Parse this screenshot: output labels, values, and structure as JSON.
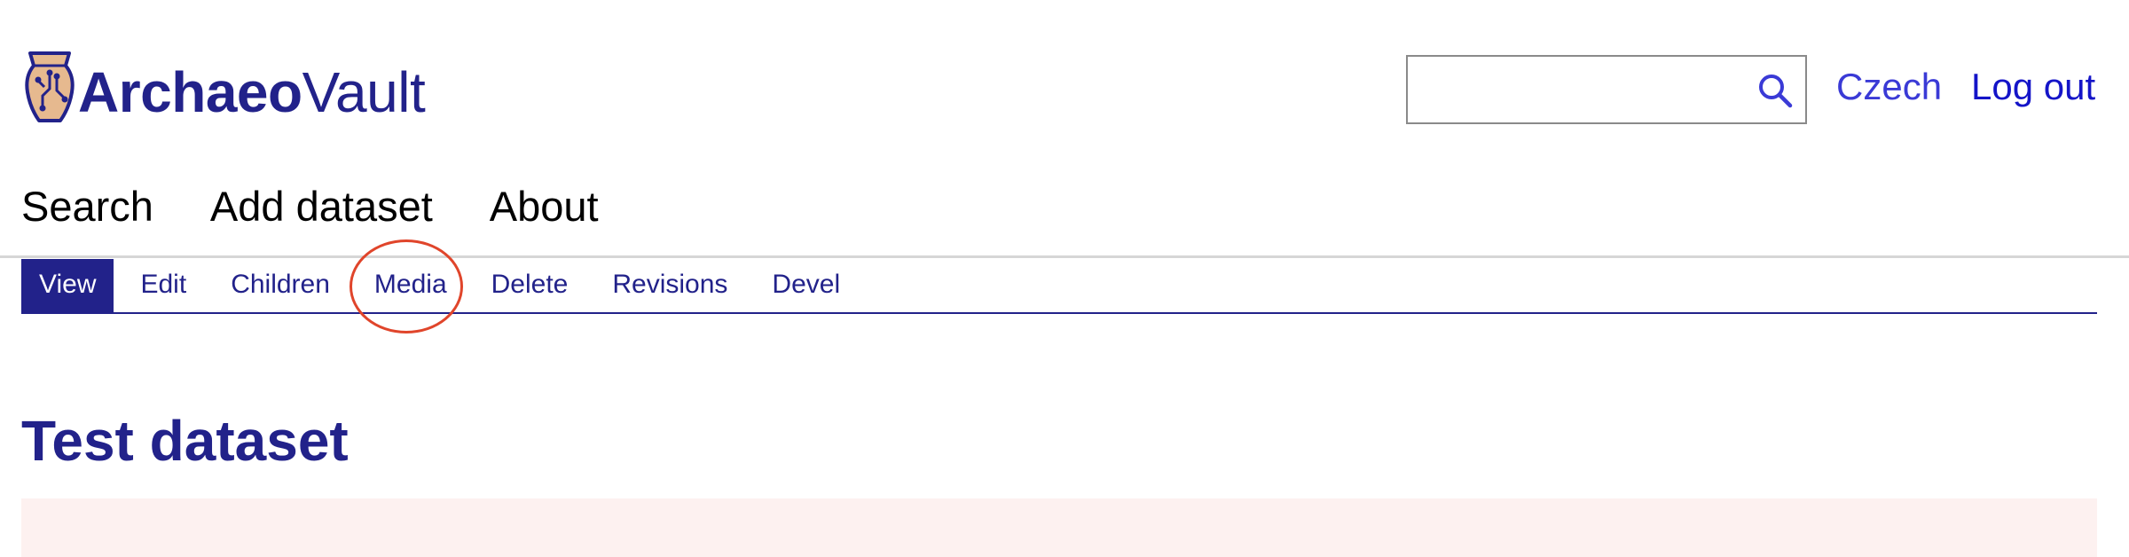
{
  "site": {
    "logo_text_bold": "Archaeo",
    "logo_text_regular": "Vault",
    "logo_icon": "amphora-circuit-icon"
  },
  "header": {
    "search": {
      "placeholder": "",
      "value": "",
      "icon": "search-icon"
    },
    "language_link": "Czech",
    "logout_link": "Log out"
  },
  "main_nav": {
    "items": [
      {
        "label": "Search"
      },
      {
        "label": "Add dataset"
      },
      {
        "label": "About"
      }
    ]
  },
  "tabs": {
    "items": [
      {
        "label": "View",
        "active": true
      },
      {
        "label": "Edit"
      },
      {
        "label": "Children"
      },
      {
        "label": "Media",
        "highlighted": true
      },
      {
        "label": "Delete"
      },
      {
        "label": "Revisions"
      },
      {
        "label": "Devel"
      }
    ]
  },
  "page": {
    "title": "Test dataset"
  },
  "colors": {
    "brand": "#22228a",
    "link": "#3a3ad6",
    "logout": "#1414c8",
    "highlight_circle": "#e0452b",
    "message_bg": "#fdf1f0",
    "logo_fill": "#e6b98f"
  }
}
